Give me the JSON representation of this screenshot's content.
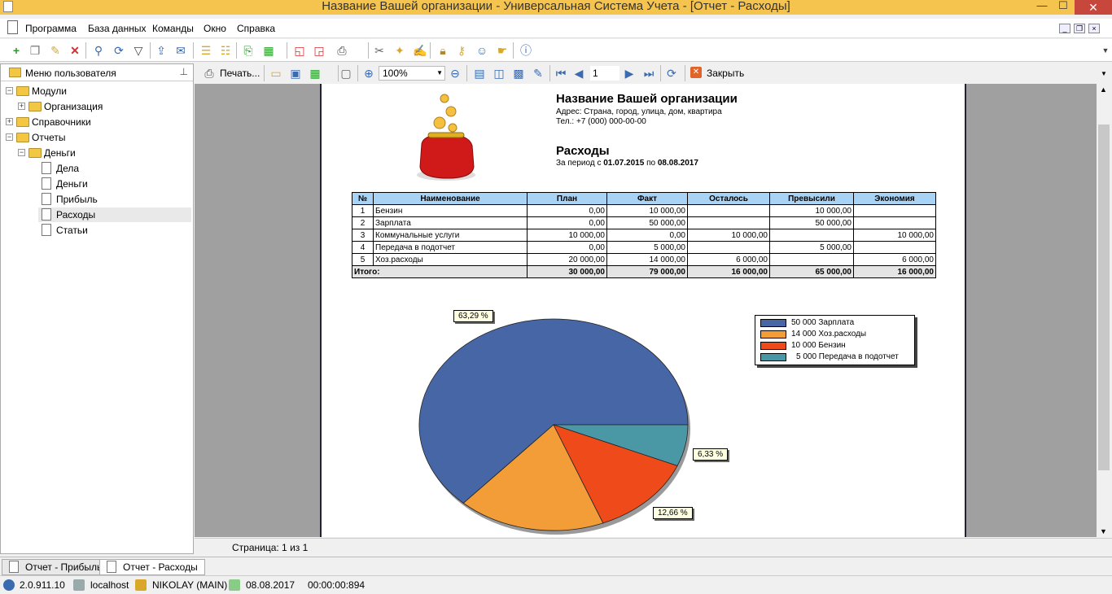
{
  "window": {
    "title": "Название Вашей организации - Универсальная Система Учета - [Отчет - Расходы]",
    "minimize": "—",
    "maximize": "☐",
    "close": "✕"
  },
  "menu": [
    "Программа",
    "База данных",
    "Команды",
    "Окно",
    "Справка"
  ],
  "sidebar": {
    "header": "Меню пользователя",
    "tree": [
      {
        "label": "Модули"
      },
      {
        "label": "Организация"
      },
      {
        "label": "Справочники"
      },
      {
        "label": "Отчеты"
      },
      {
        "label": "Деньги"
      },
      {
        "label": "Дела"
      },
      {
        "label": "Деньги"
      },
      {
        "label": "Прибыль"
      },
      {
        "label": "Расходы"
      },
      {
        "label": "Статьи"
      }
    ]
  },
  "report_toolbar": {
    "print_label": "Печать...",
    "zoom": "100%",
    "page": "1",
    "close_label": "Закрыть"
  },
  "report": {
    "org_name": "Название Вашей организации",
    "address": "Адрес: Страна, город, улица, дом, квартира",
    "phone": "Тел.: +7 (000) 000-00-00",
    "title": "Расходы",
    "period_prefix": "За период с",
    "period_from": "01.07.2015",
    "period_mid": "по",
    "period_to": "08.08.2017",
    "columns": [
      "№",
      "Наименование",
      "План",
      "Факт",
      "Осталось",
      "Превысили",
      "Экономия"
    ],
    "rows": [
      [
        "1",
        "Бензин",
        "0,00",
        "10 000,00",
        "",
        "10 000,00",
        ""
      ],
      [
        "2",
        "Зарплата",
        "0,00",
        "50 000,00",
        "",
        "50 000,00",
        ""
      ],
      [
        "3",
        "Коммунальные услуги",
        "10 000,00",
        "0,00",
        "10 000,00",
        "",
        "10 000,00"
      ],
      [
        "4",
        "Передача в подотчет",
        "0,00",
        "5 000,00",
        "",
        "5 000,00",
        ""
      ],
      [
        "5",
        "Хоз.расходы",
        "20 000,00",
        "14 000,00",
        "6 000,00",
        "",
        "6 000,00"
      ]
    ],
    "total": [
      "Итого:",
      "30 000,00",
      "79 000,00",
      "16 000,00",
      "65 000,00",
      "16 000,00"
    ]
  },
  "chart_data": {
    "type": "pie",
    "labels": [
      "50 000 Зарплата",
      "14 000 Хоз.расходы",
      "10 000 Бензин",
      "5 000 Передача в подотчет"
    ],
    "values": [
      50000,
      14000,
      10000,
      5000
    ],
    "colors": [
      "#4766a6",
      "#f29d38",
      "#ef4a1a",
      "#4a97a5"
    ],
    "slice_labels": [
      "63,29 %",
      "",
      "12,66 %",
      "6,33 %"
    ],
    "legend": "right"
  },
  "status_line": "Страница: 1 из 1",
  "tabs": [
    "Отчет - Прибыль",
    "Отчет - Расходы"
  ],
  "statusbar": {
    "version": "2.0.911.10",
    "server": "localhost",
    "user": "NIKOLAY (MAIN)",
    "date": "08.08.2017",
    "time": "00:00:00:894"
  }
}
